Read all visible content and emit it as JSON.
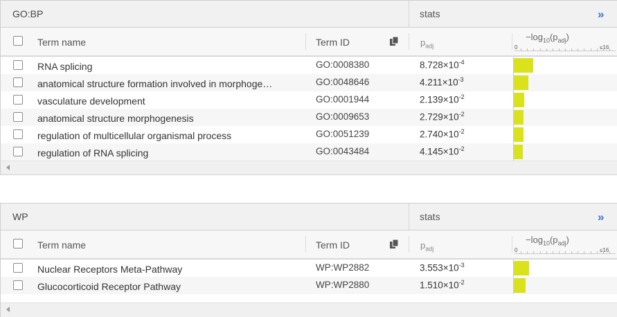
{
  "panels": [
    {
      "title": "GO:BP",
      "stats_label": "stats",
      "expand_label": "»",
      "columns": {
        "name": "Term name",
        "id": "Term ID",
        "padj": "p",
        "padj_sub": "adj",
        "log_prefix": "−log",
        "log_sub": "10",
        "log_arg": "(p",
        "log_arg_sub": "adj",
        "log_close": ")",
        "scale_min": "0",
        "scale_max": "≤16"
      },
      "rows": [
        {
          "name": "RNA splicing",
          "id": "GO:0008380",
          "mant": "8.728×10",
          "exp": "-4",
          "fraction": 0.19
        },
        {
          "name": "anatomical structure formation involved in morphoge…",
          "id": "GO:0048646",
          "mant": "4.211×10",
          "exp": "-3",
          "fraction": 0.145
        },
        {
          "name": "vasculature development",
          "id": "GO:0001944",
          "mant": "2.139×10",
          "exp": "-2",
          "fraction": 0.104
        },
        {
          "name": "anatomical structure morphogenesis",
          "id": "GO:0009653",
          "mant": "2.729×10",
          "exp": "-2",
          "fraction": 0.098
        },
        {
          "name": "regulation of multicellular organismal process",
          "id": "GO:0051239",
          "mant": "2.740×10",
          "exp": "-2",
          "fraction": 0.098
        },
        {
          "name": "regulation of RNA splicing",
          "id": "GO:0043484",
          "mant": "4.145×10",
          "exp": "-2",
          "fraction": 0.087
        }
      ]
    },
    {
      "title": "WP",
      "stats_label": "stats",
      "expand_label": "»",
      "columns": {
        "name": "Term name",
        "id": "Term ID",
        "padj": "p",
        "padj_sub": "adj",
        "log_prefix": "−log",
        "log_sub": "10",
        "log_arg": "(p",
        "log_arg_sub": "adj",
        "log_close": ")",
        "scale_min": "0",
        "scale_max": "≤16"
      },
      "rows": [
        {
          "name": "Nuclear Receptors Meta-Pathway",
          "id": "WP:WP2882",
          "mant": "3.553×10",
          "exp": "-3",
          "fraction": 0.153
        },
        {
          "name": "Glucocorticoid Receptor Pathway",
          "id": "WP:WP2880",
          "mant": "1.510×10",
          "exp": "-2",
          "fraction": 0.114
        }
      ]
    }
  ],
  "colors": {
    "bar": "#d9e21a",
    "expand": "#3b73d1"
  }
}
